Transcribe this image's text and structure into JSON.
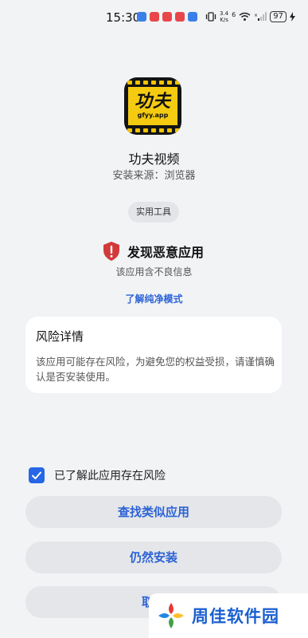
{
  "status_bar": {
    "time": "15:30",
    "net_speed_value": "3.4",
    "net_speed_unit": "K/s",
    "network_label": "6",
    "battery": "97",
    "app_icon_colors": [
      "#3b7fe8",
      "#e8464a",
      "#e8464a",
      "#e8464a",
      "#3b7fe8"
    ]
  },
  "app": {
    "icon_text": "功夫",
    "icon_subtext": "gfyy.app",
    "name": "功夫视频",
    "install_source": "安装来源：浏览器",
    "category": "实用工具"
  },
  "warning": {
    "title": "发现恶意应用",
    "subtitle": "该应用含不良信息",
    "link": "了解纯净模式",
    "accent_color": "#d23a3a"
  },
  "risk_card": {
    "title": "风险详情",
    "description": "该应用可能存在风险，为避免您的权益受损，请谨慎确认是否安装使用。"
  },
  "checkbox": {
    "label": "已了解此应用存在风险",
    "checked": true
  },
  "buttons": {
    "find_similar": "查找类似应用",
    "install_anyway": "仍然安装",
    "cancel": "取消"
  },
  "watermark": {
    "text": "周佳软件园"
  },
  "colors": {
    "accent_blue": "#2c63d6",
    "background": "#f1f3f5"
  }
}
